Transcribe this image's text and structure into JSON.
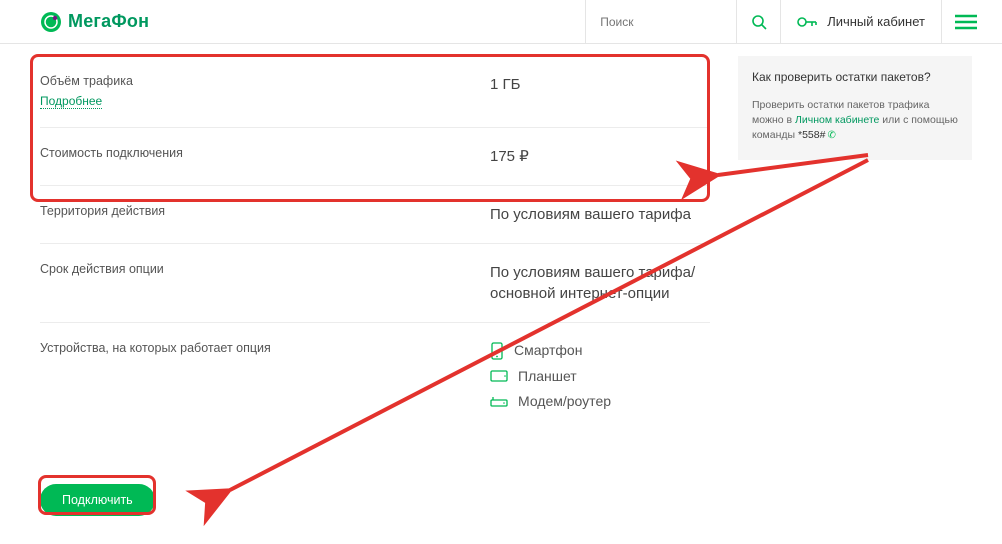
{
  "header": {
    "brand": "МегаФон",
    "search_placeholder": "Поиск",
    "lk_label": "Личный кабинет"
  },
  "rows": {
    "traffic_label": "Объём трафика",
    "traffic_value": "1 ГБ",
    "traffic_more": "Подробнее",
    "cost_label": "Стоимость подключения",
    "cost_value": "175 ₽",
    "territory_label": "Территория действия",
    "territory_value": "По условиям вашего тарифа",
    "duration_label": "Срок действия опции",
    "duration_value": "По условиям вашего тарифа/основной интернет-опции",
    "devices_label": "Устройства, на которых работает опция",
    "device1": "Смартфон",
    "device2": "Планшет",
    "device3": "Модем/роутер"
  },
  "connect_label": "Подключить",
  "sidebar": {
    "title": "Как проверить остатки пакетов?",
    "text_before": "Проверить остатки пакетов трафика можно в ",
    "lk_link": "Личном кабинете",
    "text_mid": " или с помощью команды ",
    "cmd": "*558#"
  }
}
